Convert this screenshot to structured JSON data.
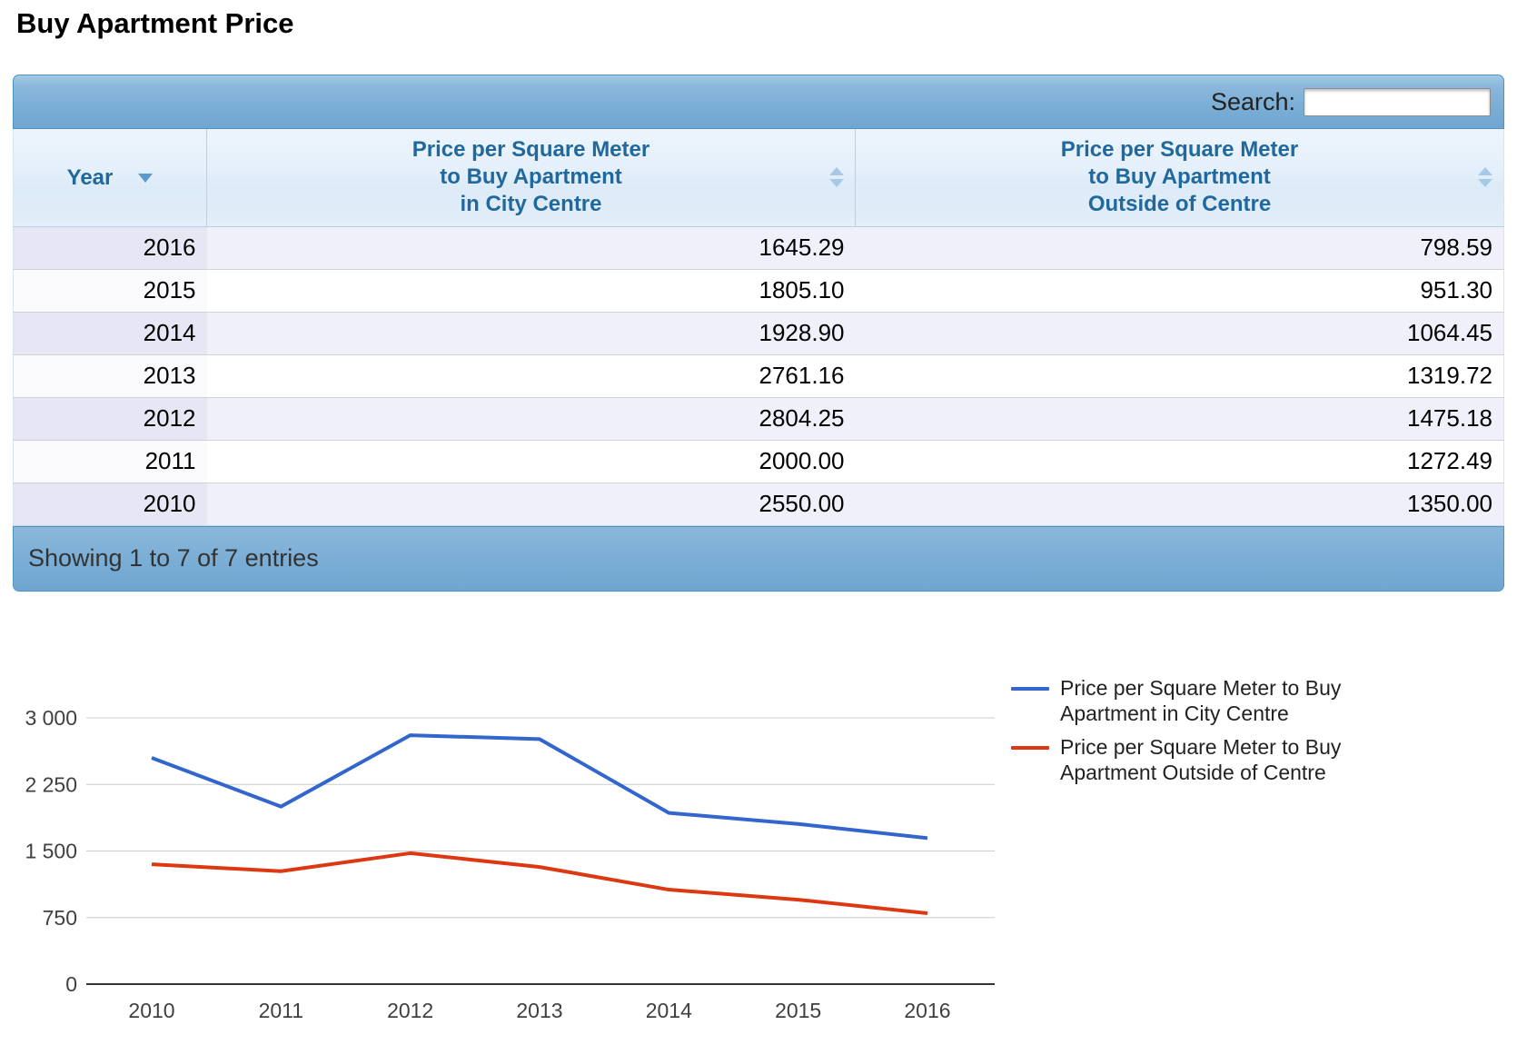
{
  "title": "Buy Apartment Price",
  "table": {
    "search_label": "Search:",
    "search_value": "",
    "columns": [
      {
        "label": "Year",
        "sort": "desc"
      },
      {
        "label": "Price per Square Meter\nto Buy Apartment\nin City Centre",
        "sort": "both"
      },
      {
        "label": "Price per Square Meter\nto Buy Apartment\nOutside of Centre",
        "sort": "both"
      }
    ],
    "rows": [
      [
        "2016",
        "1645.29",
        "798.59"
      ],
      [
        "2015",
        "1805.10",
        "951.30"
      ],
      [
        "2014",
        "1928.90",
        "1064.45"
      ],
      [
        "2013",
        "2761.16",
        "1319.72"
      ],
      [
        "2012",
        "2804.25",
        "1475.18"
      ],
      [
        "2011",
        "2000.00",
        "1272.49"
      ],
      [
        "2010",
        "2550.00",
        "1350.00"
      ]
    ],
    "info_text": "Showing 1 to 7 of 7 entries"
  },
  "chart_data": {
    "type": "line",
    "categories": [
      "2010",
      "2011",
      "2012",
      "2013",
      "2014",
      "2015",
      "2016"
    ],
    "series": [
      {
        "name": "Price per Square Meter to Buy Apartment in City Centre",
        "color": "#3366cc",
        "values": [
          2550.0,
          2000.0,
          2804.25,
          2761.16,
          1928.9,
          1805.1,
          1645.29
        ]
      },
      {
        "name": "Price per Square Meter to Buy Apartment Outside of Centre",
        "color": "#dc3912",
        "values": [
          1350.0,
          1272.49,
          1475.18,
          1319.72,
          1064.45,
          951.3,
          798.59
        ]
      }
    ],
    "xlabel": "",
    "ylabel": "",
    "ylim": [
      0,
      3000
    ],
    "yticks": [
      {
        "v": 0,
        "label": "0"
      },
      {
        "v": 750,
        "label": "750"
      },
      {
        "v": 1500,
        "label": "1 500"
      },
      {
        "v": 2250,
        "label": "2 250"
      },
      {
        "v": 3000,
        "label": "3 000"
      }
    ],
    "grid": true,
    "legend_position": "right",
    "axis_color": "#333333",
    "grid_color": "#cccccc"
  }
}
